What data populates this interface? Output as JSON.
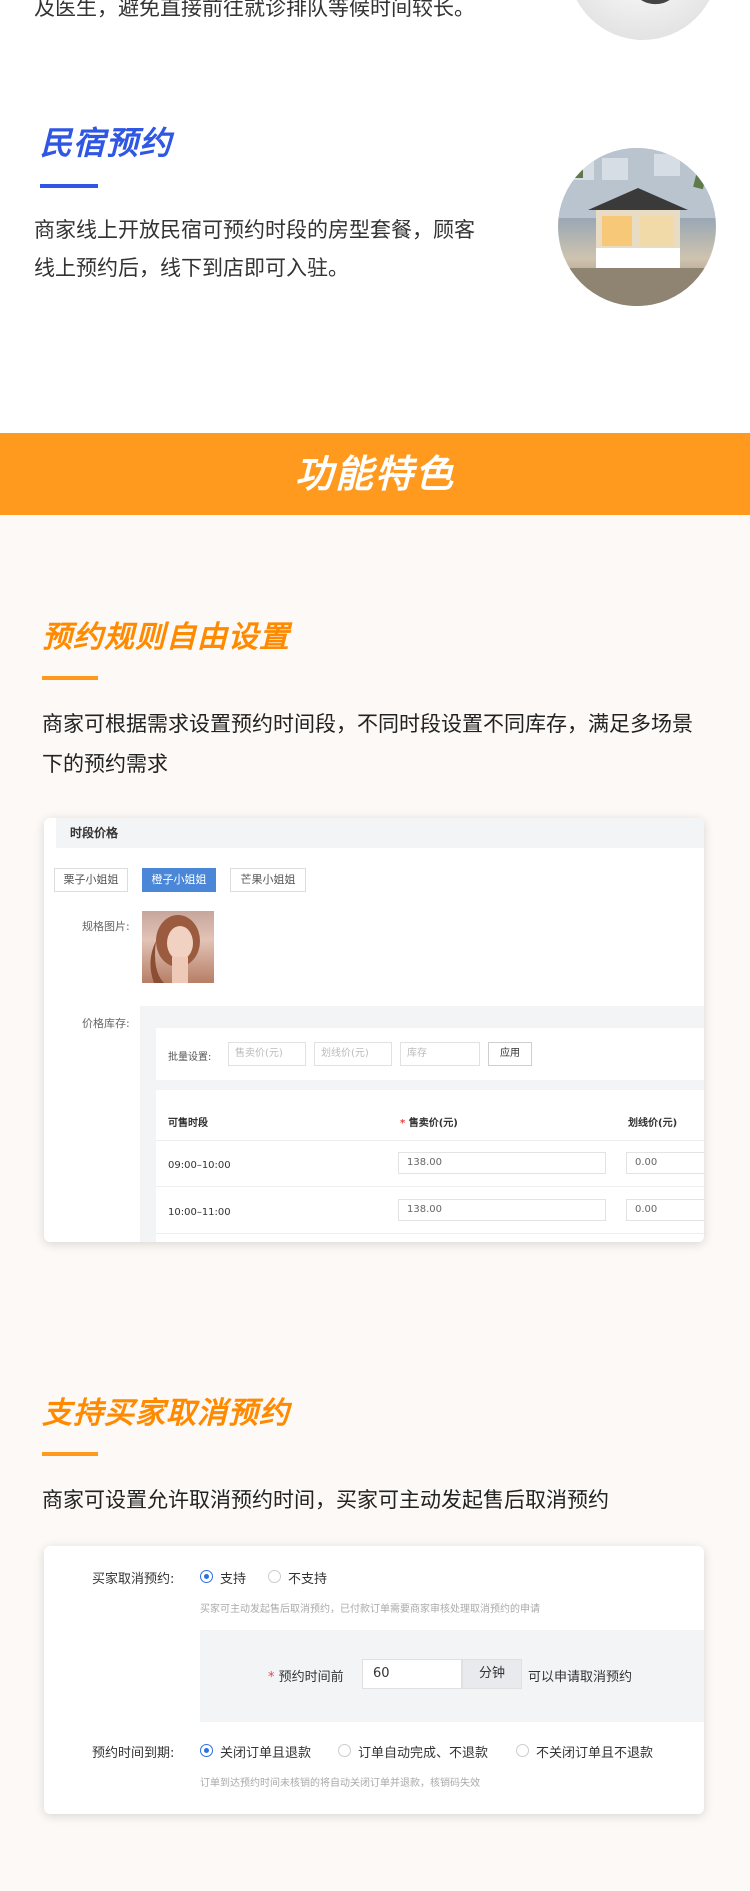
{
  "intro": {
    "top_text": "及医生，避免直接前往就诊排队等候时间较长。"
  },
  "homestay": {
    "title": "民宿预约",
    "desc_line1": "商家线上开放民宿可预约时段的房型套餐，顾客",
    "desc_line2": "线上预约后，线下到店即可入驻。"
  },
  "features": {
    "title": "功能特色"
  },
  "rules": {
    "title": "预约规则自由设置",
    "desc_line1": "商家可根据需求设置预约时间段，不同时段设置不同库存，满足多场景",
    "desc_line2": "下的预约需求"
  },
  "card1": {
    "header": "时段价格",
    "tabs": [
      {
        "label": "栗子小姐姐"
      },
      {
        "label": "橙子小姐姐"
      },
      {
        "label": "芒果小姐姐"
      }
    ],
    "spec_image_label": "规格图片:",
    "price_stock_label": "价格库存:",
    "batch_label": "批量设置:",
    "batch_sale_placeholder": "售卖价(元)",
    "batch_strike_placeholder": "划线价(元)",
    "batch_stock_placeholder": "库存",
    "apply_label": "应用",
    "columns": {
      "slot": "可售时段",
      "required_mark": "*",
      "sale": "售卖价(元)",
      "strike": "划线价(元)"
    },
    "rows": [
      {
        "slot": "09:00–10:00",
        "sale": "138.00",
        "strike": "0.00"
      },
      {
        "slot": "10:00–11:00",
        "sale": "138.00",
        "strike": "0.00"
      }
    ]
  },
  "cancel": {
    "title": "支持买家取消预约",
    "desc": "商家可设置允许取消预约时间，买家可主动发起售后取消预约"
  },
  "card2": {
    "cancel_label": "买家取消预约:",
    "support": "支持",
    "not_support": "不支持",
    "cancel_hint": "买家可主动发起售后取消预约，已付款订单需要商家审核处理取消预约的申请",
    "required_mark": "*",
    "before_label": "预约时间前",
    "minutes_value": "60",
    "minutes_unit": "分钟",
    "after_label": "可以申请取消预约",
    "expire_label": "预约时间到期:",
    "opt_close_refund": "关闭订单且退款",
    "opt_auto_complete": "订单自动完成、不退款",
    "opt_no_close": "不关闭订单且不退款",
    "expire_hint": "订单到达预约时间未核销的将自动关闭订单并退款，核销码失效"
  },
  "colors": {
    "blue_accent": "#2f57e3",
    "orange_accent": "#ff9a1f",
    "selected_tab": "#4a87d8"
  }
}
